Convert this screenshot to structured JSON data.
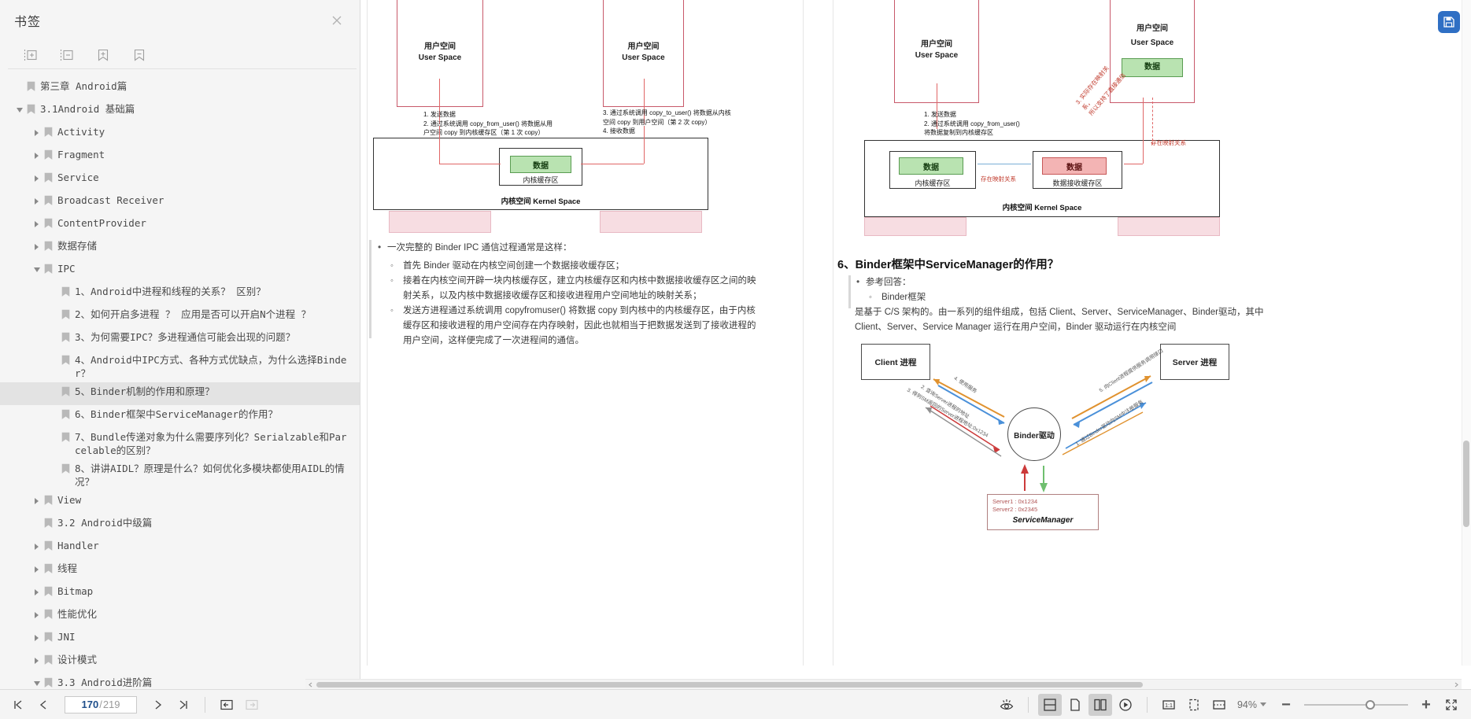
{
  "sidebar": {
    "title": "书签",
    "close_icon": "close-icon",
    "tools": [
      {
        "name": "expand-all-button",
        "icon": "expand-all-icon"
      },
      {
        "name": "collapse-all-button",
        "icon": "collapse-all-icon"
      },
      {
        "name": "add-bookmark-button",
        "icon": "bookmark-plus-icon"
      },
      {
        "name": "remove-bookmark-button",
        "icon": "bookmark-minus-icon"
      }
    ],
    "tree": [
      {
        "label": "第三章 Android篇",
        "indent": 1,
        "twist": "none",
        "selected": false
      },
      {
        "label": "3.1Android 基础篇",
        "indent": 1,
        "twist": "open",
        "selected": false
      },
      {
        "label": "Activity",
        "indent": 2,
        "twist": "closed",
        "selected": false
      },
      {
        "label": "Fragment",
        "indent": 2,
        "twist": "closed",
        "selected": false
      },
      {
        "label": "Service",
        "indent": 2,
        "twist": "closed",
        "selected": false
      },
      {
        "label": "Broadcast Receiver",
        "indent": 2,
        "twist": "closed",
        "selected": false
      },
      {
        "label": "ContentProvider",
        "indent": 2,
        "twist": "closed",
        "selected": false
      },
      {
        "label": "数据存储",
        "indent": 2,
        "twist": "closed",
        "selected": false
      },
      {
        "label": "IPC",
        "indent": 2,
        "twist": "open",
        "selected": false
      },
      {
        "label": "1、Android中进程和线程的关系？ 区别？",
        "indent": 3,
        "twist": "none",
        "selected": false
      },
      {
        "label": "2、如何开启多进程 ？ 应用是否可以开启N个进程 ？",
        "indent": 3,
        "twist": "none",
        "selected": false
      },
      {
        "label": "3、为何需要IPC？多进程通信可能会出现的问题？",
        "indent": 3,
        "twist": "none",
        "selected": false
      },
      {
        "label": "4、Android中IPC方式、各种方式优缺点，为什么选择Binder？",
        "indent": 3,
        "twist": "none",
        "selected": false
      },
      {
        "label": "5、Binder机制的作用和原理？",
        "indent": 3,
        "twist": "none",
        "selected": true
      },
      {
        "label": "6、Binder框架中ServiceManager的作用？",
        "indent": 3,
        "twist": "none",
        "selected": false
      },
      {
        "label": "7、Bundle传递对象为什么需要序列化？Serialzable和Parcelable的区别？",
        "indent": 3,
        "twist": "none",
        "selected": false
      },
      {
        "label": "8、讲讲AIDL？原理是什么？如何优化多模块都使用AIDL的情况？",
        "indent": 3,
        "twist": "none",
        "selected": false
      },
      {
        "label": "View",
        "indent": 2,
        "twist": "closed",
        "selected": false
      },
      {
        "label": "3.2 Android中级篇",
        "indent": 2,
        "twist": "none",
        "selected": false
      },
      {
        "label": "Handler",
        "indent": 2,
        "twist": "closed",
        "selected": false
      },
      {
        "label": "线程",
        "indent": 2,
        "twist": "closed",
        "selected": false
      },
      {
        "label": "Bitmap",
        "indent": 2,
        "twist": "closed",
        "selected": false
      },
      {
        "label": "性能优化",
        "indent": 2,
        "twist": "closed",
        "selected": false
      },
      {
        "label": "JNI",
        "indent": 2,
        "twist": "closed",
        "selected": false
      },
      {
        "label": "设计模式",
        "indent": 2,
        "twist": "closed",
        "selected": false
      },
      {
        "label": "3.3 Android进阶篇",
        "indent": 2,
        "twist": "open",
        "selected": false
      }
    ]
  },
  "document": {
    "left_page": {
      "diagram": {
        "user_space_left": {
          "cn": "用户空间",
          "en": "User Space"
        },
        "user_space_right": {
          "cn": "用户空间",
          "en": "User Space"
        },
        "kernel_space": "内核空间 Kernel Space",
        "kernel_buffer_caption": "内核缓存区",
        "data_box": "数据",
        "note_left": "1. 发送数据\n2. 通过系统调用 copy_from_user() 将数据从用\n    户空间 copy 到内核缓存区（第 1 次 copy）",
        "note_right": "3. 通过系统调用 copy_to_user() 将数据从内核\n    空间 copy 到用户空间（第 2 次 copy）\n4. 接收数据"
      },
      "bullets": [
        {
          "level": 1,
          "text": "一次完整的 Binder IPC 通信过程通常是这样："
        },
        {
          "level": 2,
          "text": "首先 Binder 驱动在内核空间创建一个数据接收缓存区；"
        },
        {
          "level": 2,
          "text": "接着在内核空间开辟一块内核缓存区，建立内核缓存区和内核中数据接收缓存区之间的映射关系，以及内核中数据接收缓存区和接收进程用户空间地址的映射关系；"
        },
        {
          "level": 2,
          "text": "发送方进程通过系统调用 copyfromuser() 将数据 copy 到内核中的内核缓存区，由于内核缓存区和接收进程的用户空间存在内存映射，因此也就相当于把数据发送到了接收进程的用户空间，这样便完成了一次进程间的通信。"
        }
      ]
    },
    "right_page": {
      "diagram_top": {
        "user_space_left": {
          "cn": "用户空间",
          "en": "User Space"
        },
        "user_space_right": {
          "cn": "用户空间",
          "en": "User Space"
        },
        "kernel_space": "内核空间 Kernel Space",
        "data_box": "数据",
        "kernel_buffer_caption": "内核缓存区",
        "recv_buffer_caption": "数据接收缓存区",
        "mapping_label_1": "存在映射关系",
        "mapping_label_2": "存在映射关系",
        "note_left": "1. 发送数据\n2. 通过系统调用 copy_from_user()\n    将数据复制到内核缓存区",
        "rot_label": "3. 实际存在映射关系，\n    所以支持了直接通信"
      },
      "heading": "6、Binder框架中ServiceManager的作用？",
      "bullets": [
        {
          "level": 1,
          "text": "参考回答："
        },
        {
          "level": 2,
          "text": "Binder框架"
        }
      ],
      "paragraph": "是基于 C/S 架构的。由一系列的组件组成，包括 Client、Server、ServiceManager、Binder驱动，其中 Client、Server、Service Manager 运行在用户空间，Binder 驱动运行在内核空间",
      "diagram_bottom": {
        "client_node": "Client 进程",
        "server_node": "Server 进程",
        "binder_node": "Binder驱动",
        "sm_node": "ServiceManager",
        "sm_list_1": "Server1 : 0x1234",
        "sm_list_2": "Server2 : 0x2345",
        "edges": [
          "1. 通过Binder驱动向SM中注册服务",
          "2. 查询Server进程的地址",
          "3. 得到SM返回的Server进程地址:0x1234",
          "4. 使用服务",
          "5. 向Client进程提供服务调用接口"
        ]
      }
    }
  },
  "toolbar": {
    "first_page": {
      "name": "first-page-button",
      "icon": "skip-to-start-icon"
    },
    "prev_page": {
      "name": "previous-page-button",
      "icon": "chevron-left-icon"
    },
    "page_current": "170",
    "page_separator": "/",
    "page_total": "219",
    "next_page": {
      "name": "next-page-button",
      "icon": "chevron-right-icon"
    },
    "last_page": {
      "name": "last-page-button",
      "icon": "skip-to-end-icon"
    },
    "go_back": {
      "name": "navigate-back-button",
      "icon": "arrow-left-boxed-icon",
      "enabled": true
    },
    "go_forward": {
      "name": "navigate-forward-button",
      "icon": "arrow-right-boxed-icon",
      "enabled": false
    },
    "eye_protect": {
      "name": "eye-protection-button",
      "icon": "eye-icon"
    },
    "view_scroll": {
      "name": "continuous-scroll-button",
      "icon": "split-horizontal-icon",
      "active": true
    },
    "view_single": {
      "name": "single-page-button",
      "icon": "single-page-icon",
      "active": false
    },
    "view_double": {
      "name": "double-page-button",
      "icon": "double-page-icon",
      "active": true
    },
    "presentation": {
      "name": "presentation-mode-button",
      "icon": "play-circle-icon"
    },
    "actual_size": {
      "name": "actual-size-button",
      "icon": "one-to-one-icon"
    },
    "fit_page": {
      "name": "fit-page-button",
      "icon": "fit-page-icon"
    },
    "fit_width": {
      "name": "fit-width-button",
      "icon": "fit-width-icon"
    },
    "zoom_value": "94%",
    "zoom_out": {
      "name": "zoom-out-button",
      "icon": "minus-icon"
    },
    "zoom_in": {
      "name": "zoom-in-button",
      "icon": "plus-icon"
    },
    "fullscreen": {
      "name": "fullscreen-button",
      "icon": "expand-arrows-icon"
    }
  },
  "floating": {
    "save_button": {
      "name": "save-button",
      "icon": "save-icon",
      "color": "#2f6fc4"
    }
  }
}
